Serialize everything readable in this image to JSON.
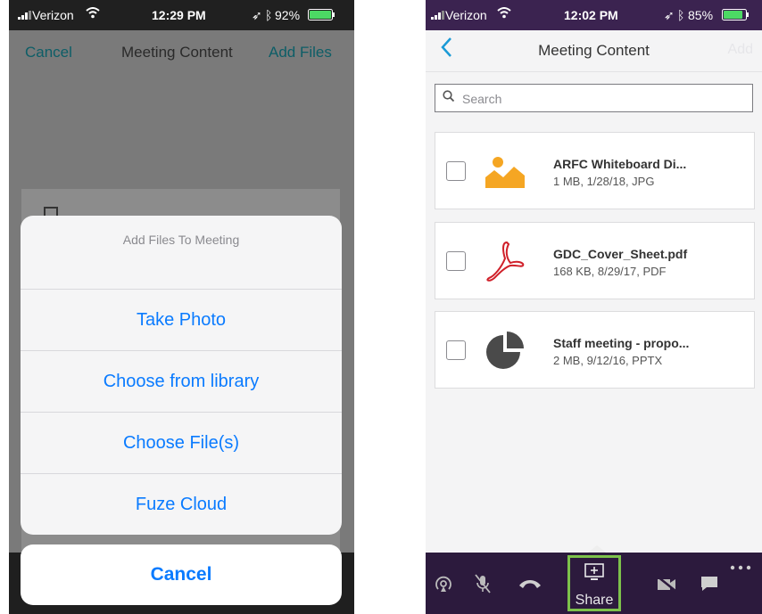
{
  "left": {
    "status": {
      "carrier": "Verizon",
      "time": "12:29 PM",
      "battery": "92%"
    },
    "nav": {
      "cancel": "Cancel",
      "title": "Meeting Content",
      "add_files": "Add Files"
    },
    "sheet": {
      "title": "Add Files To Meeting",
      "options": [
        "Take Photo",
        "Choose from library",
        "Choose File(s)",
        "Fuze Cloud"
      ],
      "cancel": "Cancel"
    }
  },
  "right": {
    "status": {
      "carrier": "Verizon",
      "time": "12:02 PM",
      "battery": "85%"
    },
    "nav": {
      "back_icon": "chevron-left-icon",
      "title": "Meeting Content",
      "add": "Add"
    },
    "search": {
      "placeholder": "Search"
    },
    "files": [
      {
        "name": "ARFC Whiteboard Di...",
        "meta": "1 MB, 1/28/18, JPG",
        "icon": "image-icon",
        "checked": false
      },
      {
        "name": "GDC_Cover_Sheet.pdf",
        "meta": "168 KB, 8/29/17, PDF",
        "icon": "pdf-icon",
        "checked": false
      },
      {
        "name": "Staff meeting - propo...",
        "meta": "2 MB, 9/12/16, PPTX",
        "icon": "presentation-icon",
        "checked": false
      }
    ],
    "toolbar": {
      "share_label": "Share"
    }
  },
  "colors": {
    "ios_blue": "#0a7bff",
    "teal": "#1a9ad6",
    "purple": "#2c1a3d",
    "share_highlight": "#7dc24b",
    "image_orange": "#f5a623",
    "pdf_red": "#d0202a"
  }
}
